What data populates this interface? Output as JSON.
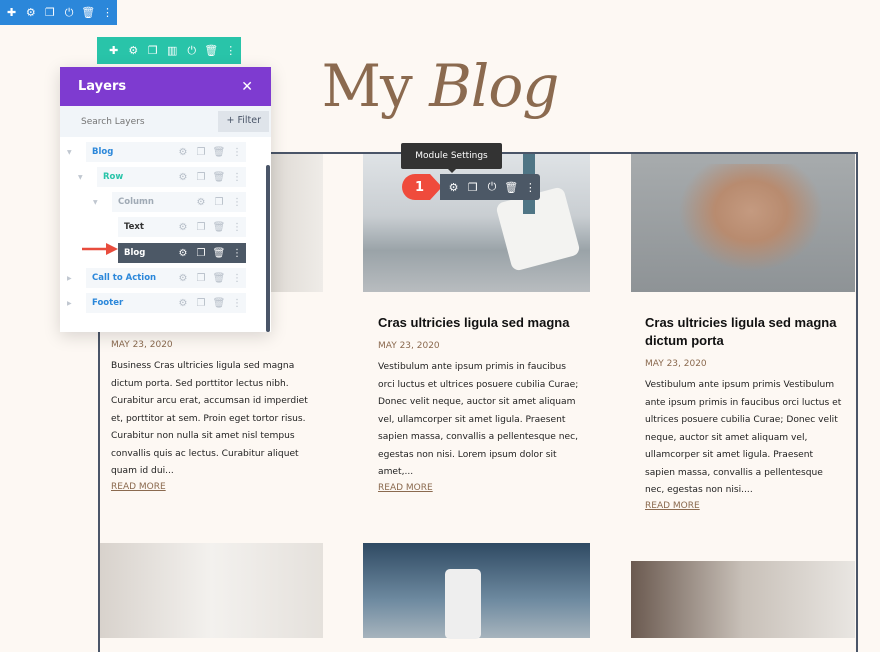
{
  "toolbars": {
    "section": [
      "move-icon",
      "gear-icon",
      "duplicate-icon",
      "power-icon",
      "trash-icon",
      "more-icon"
    ],
    "row": [
      "move-icon",
      "gear-icon",
      "duplicate-icon",
      "columns-icon",
      "power-icon",
      "trash-icon",
      "more-icon"
    ],
    "module": [
      "gear-icon",
      "duplicate-icon",
      "power-icon",
      "trash-icon",
      "more-icon"
    ],
    "section_color": "#2b87da",
    "row_color": "#29c4a9",
    "module_color": "#4c5866"
  },
  "page": {
    "title_plain": "My ",
    "title_italic": "Blog",
    "title_color": "#8b6a4f"
  },
  "tooltip": "Module Settings",
  "step_badge": "1",
  "layers": {
    "title": "Layers",
    "search_placeholder": "Search Layers",
    "filter_label": "+ Filter",
    "items": [
      {
        "label": "Blog",
        "color": "#2b87da"
      },
      {
        "label": "Row",
        "color": "#29c4a9"
      },
      {
        "label": "Column",
        "color": "#a0aab5"
      },
      {
        "label": "Text",
        "color": "#333"
      },
      {
        "label": "Blog",
        "color": "#fff",
        "active": true
      },
      {
        "label": "Call to Action",
        "color": "#2b87da"
      },
      {
        "label": "Footer",
        "color": "#2b87da"
      }
    ]
  },
  "posts": [
    {
      "title": "",
      "date": "MAY 23, 2020",
      "excerpt": "Business Cras ultricies ligula sed magna dictum porta. Sed porttitor lectus nibh. Curabitur arcu erat, accumsan id imperdiet et, porttitor at sem. Proin eget tortor risus. Curabitur non nulla sit amet nisl tempus convallis quis ac lectus. Curabitur aliquet quam id dui...",
      "read_more": "READ MORE"
    },
    {
      "title": "Cras ultricies ligula sed magna",
      "date": "MAY 23, 2020",
      "excerpt": "Vestibulum ante ipsum primis in faucibus orci luctus et ultrices posuere cubilia Curae; Donec velit neque, auctor sit amet aliquam vel, ullamcorper sit amet ligula. Praesent sapien massa, convallis a pellentesque nec, egestas non nisi. Lorem ipsum dolor sit amet,...",
      "read_more": "READ MORE"
    },
    {
      "title": "Cras ultricies ligula sed magna dictum porta",
      "date": "MAY 23, 2020",
      "excerpt": "Vestibulum ante ipsum primis Vestibulum ante ipsum primis in faucibus orci luctus et ultrices posuere cubilia Curae; Donec velit neque, auctor sit amet aliquam vel, ullamcorper sit amet ligula. Praesent sapien massa, convallis a pellentesque nec, egestas non nisi....",
      "read_more": "READ MORE"
    }
  ]
}
